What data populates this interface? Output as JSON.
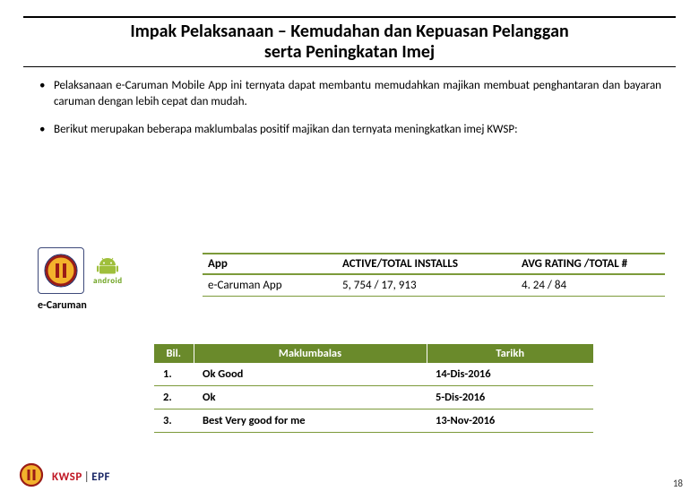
{
  "title_line1": "Impak Pelaksanaan – Kemudahan dan Kepuasan Pelanggan",
  "title_line2": "serta Peningkatan Imej",
  "bullets": [
    "Pelaksanaan e-Caruman Mobile App ini ternyata dapat membantu memudahkan majikan membuat penghantaran dan bayaran caruman dengan lebih cepat dan mudah.",
    "Berikut merupakan beberapa maklumbalas positif majikan dan ternyata meningkatkan imej KWSP:"
  ],
  "app_caption": "e-Caruman",
  "android_label": "android",
  "stats": {
    "headers": [
      "App",
      "ACTIVE/TOTAL INSTALLS",
      "AVG RATING /TOTAL #"
    ],
    "row": {
      "app": "e-Caruman App",
      "installs": "5, 754 / 17, 913",
      "rating": "4. 24 / 84"
    }
  },
  "feedback": {
    "headers": [
      "Bil.",
      "Maklumbalas",
      "Tarikh"
    ],
    "rows": [
      {
        "n": "1.",
        "msg": "Ok Good",
        "date": "14-Dis-2016"
      },
      {
        "n": "2.",
        "msg": "Ok",
        "date": "5-Dis-2016"
      },
      {
        "n": "3.",
        "msg": "Best Very good for me",
        "date": "13-Nov-2016"
      }
    ]
  },
  "footer": {
    "kwsp": "KWSP",
    "epf": "EPF"
  },
  "page_number": "18"
}
